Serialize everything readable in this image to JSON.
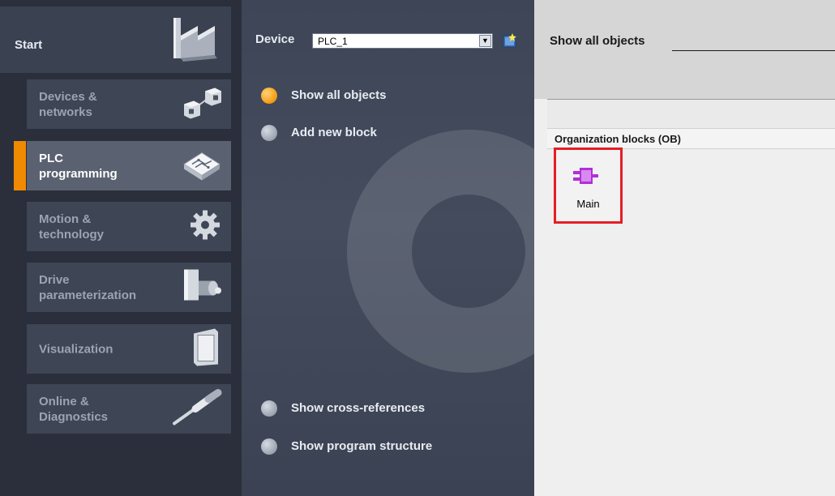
{
  "left_nav": {
    "start_label": "Start",
    "items": [
      {
        "label_line1": "Devices &",
        "label_line2": "networks",
        "icon": "devices-networks-icon",
        "active": false
      },
      {
        "label_line1": "PLC",
        "label_line2": "programming",
        "icon": "plc-programming-icon",
        "active": true
      },
      {
        "label_line1": "Motion &",
        "label_line2": "technology",
        "icon": "gear-icon",
        "active": false
      },
      {
        "label_line1": "Drive",
        "label_line2": "parameterization",
        "icon": "drive-motor-icon",
        "active": false
      },
      {
        "label_line1": "Visualization",
        "label_line2": "",
        "icon": "hmi-panel-icon",
        "active": false
      },
      {
        "label_line1": "Online &",
        "label_line2": "Diagnostics",
        "icon": "screwdriver-icon",
        "active": false
      }
    ]
  },
  "device": {
    "label": "Device",
    "selected": "PLC_1",
    "dropdown_arrow": "▼"
  },
  "actions": [
    {
      "label": "Show all objects",
      "selected": true
    },
    {
      "label": "Add new block",
      "selected": false
    },
    {
      "label": "Show cross-references",
      "selected": false
    },
    {
      "label": "Show program structure",
      "selected": false
    }
  ],
  "right_pane": {
    "title": "Show all objects",
    "section_header": "Organization blocks (OB)",
    "blocks": [
      {
        "name": "Main",
        "icon": "organization-block-icon",
        "highlighted": true
      }
    ]
  },
  "colors": {
    "accent_orange": "#f08a00",
    "highlight_red": "#e61e25",
    "block_purple": "#b12fd8"
  }
}
